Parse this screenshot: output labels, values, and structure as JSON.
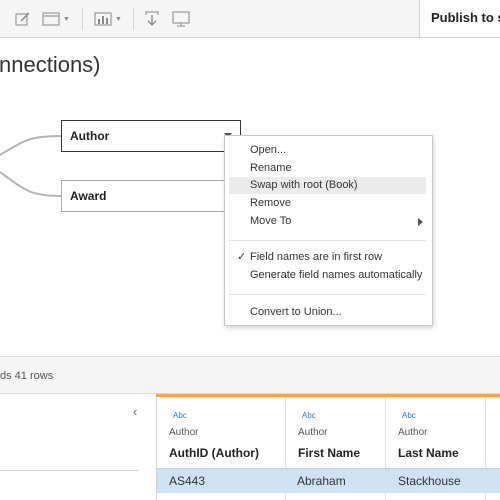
{
  "toolbar": {
    "icons": [
      "edit-icon",
      "table-layout-icon",
      "chart-icon",
      "import-icon",
      "present-icon"
    ],
    "publish_label": "Publish to sav"
  },
  "canvas": {
    "title": "nnections)",
    "tables": [
      {
        "label": "Author",
        "selected": true
      },
      {
        "label": "Award",
        "selected": false
      }
    ]
  },
  "context_menu": {
    "items": [
      {
        "label": "Open...",
        "highlighted": false
      },
      {
        "label": "Rename",
        "highlighted": false
      },
      {
        "label": "Swap with root (Book)",
        "highlighted": true
      },
      {
        "label": "Remove",
        "highlighted": false
      },
      {
        "label": "Move To",
        "highlighted": false,
        "submenu": true
      },
      {
        "label": "Field names are in first row",
        "checked": true
      },
      {
        "label": "Generate field names automatically",
        "checked": false
      },
      {
        "label": "Convert to Union...",
        "checked": false
      }
    ]
  },
  "status": {
    "text": "ds 41 rows"
  },
  "grid": {
    "columns": [
      {
        "type": "Abc",
        "source": "Author",
        "name": "AuthID (Author)"
      },
      {
        "type": "Abc",
        "source": "Author",
        "name": "First Name"
      },
      {
        "type": "Abc",
        "source": "Author",
        "name": "Last Name"
      }
    ],
    "rows": [
      [
        "AS443",
        "Abraham",
        "Stackhouse"
      ]
    ]
  },
  "colors": {
    "accent_orange": "#f4a448",
    "selected_row": "#cfe2f3",
    "type_blue": "#2e7bbd"
  }
}
